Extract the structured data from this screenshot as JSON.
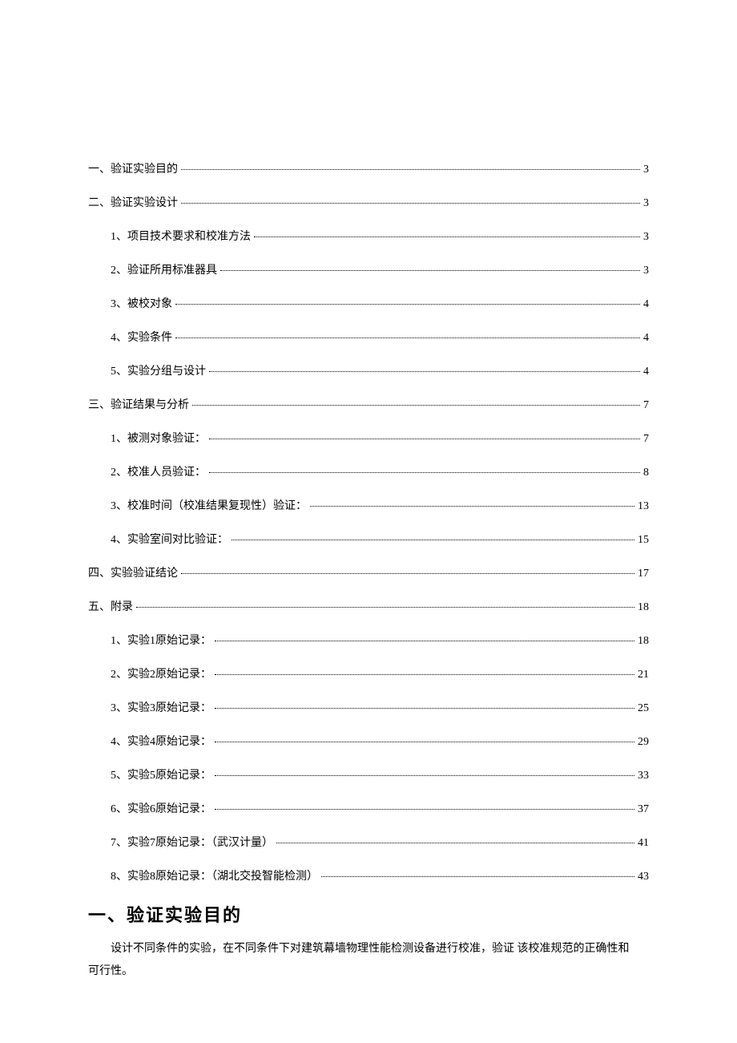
{
  "toc": [
    {
      "indent": false,
      "label": "一、验证实验目的",
      "page": "3"
    },
    {
      "indent": false,
      "label": "二、验证实验设计",
      "page": "3"
    },
    {
      "indent": true,
      "label": "1、项目技术要求和校准方法 ",
      "page": "3"
    },
    {
      "indent": true,
      "label": "2、验证所用标准器具 ",
      "page": "3"
    },
    {
      "indent": true,
      "label": "3、被校对象 ",
      "page": "4"
    },
    {
      "indent": true,
      "label": "4、实验条件 ",
      "page": "4"
    },
    {
      "indent": true,
      "label": "5、实验分组与设计 ",
      "page": "4"
    },
    {
      "indent": false,
      "label": "三、验证结果与分析",
      "page": "7"
    },
    {
      "indent": true,
      "label": "1、被测对象验证： ",
      "page": "7"
    },
    {
      "indent": true,
      "label": "2、校准人员验证： ",
      "page": "8"
    },
    {
      "indent": true,
      "label": "3、校准时间（校准结果复现性）验证： ",
      "page": "13"
    },
    {
      "indent": true,
      "label": "4、实验室间对比验证： ",
      "page": "15"
    },
    {
      "indent": false,
      "label": "四、实验验证结论",
      "page": "17"
    },
    {
      "indent": false,
      "label": "五、附录",
      "page": "18"
    },
    {
      "indent": true,
      "label": "1、实验1原始记录： ",
      "page": "18"
    },
    {
      "indent": true,
      "label": "2、实验2原始记录： ",
      "page": "21"
    },
    {
      "indent": true,
      "label": "3、实验3原始记录： ",
      "page": "25"
    },
    {
      "indent": true,
      "label": "4、实验4原始记录： ",
      "page": "29"
    },
    {
      "indent": true,
      "label": "5、实验5原始记录： ",
      "page": "33"
    },
    {
      "indent": true,
      "label": "6、实验6原始记录： ",
      "page": "37"
    },
    {
      "indent": true,
      "label": "7、实验7原始记录：（武汉计量） ",
      "page": "41"
    },
    {
      "indent": true,
      "label": "8、实验8原始记录：（湖北交投智能检测） ",
      "page": "43"
    }
  ],
  "section1": {
    "heading": "一、验证实验目的",
    "para_line1": "设计不同条件的实验，在不同条件下对建筑幕墙物理性能检测设备进行校准，验证 该校准规范的正确性和",
    "para_line2": "可行性。"
  }
}
